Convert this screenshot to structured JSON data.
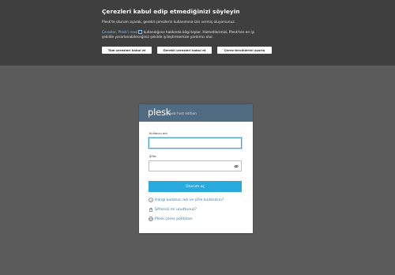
{
  "cookie_banner": {
    "title": "Çerezleri kabul edip etmediğinizi söyleyin",
    "intro": "Plesk'te oturum açarak, gerekli çerezlerin kullanımına izin vermiş oluyorsunuz.",
    "link_text": "Çerezler, Plesk'i nasıl",
    "more_text_line1": "kullandığınız hakkında bilgi toplar. Hizmetlerimizi, Plesk'ten en iyi",
    "more_text_line2": "şekilde yararlanabileceğiniz şekilde iyileştirmemize yardımcı olur.",
    "buttons": {
      "accept_all": "Tüm çerezleri kabul et",
      "accept_required": "Gerekli çerezleri kabul et",
      "configure": "Çerez tercihlerini ayarla"
    }
  },
  "login": {
    "logo": "plesk",
    "edition": "web host edition",
    "username_label": "Kullanıcı adı",
    "username_value": "",
    "password_label": "Şifre",
    "password_value": "",
    "submit_label": "Oturum aç",
    "links": {
      "which_credentials": "Hangi kullanıcı adı ve şifre kullanılsın?",
      "forgot_password": "Şifrenizi mi unuttunuz?",
      "cookie_policy": "Plesk çerez politikası"
    }
  },
  "colors": {
    "background": "#5b5b5b",
    "banner": "#3f3f3f",
    "header": "#516b82",
    "button": "#28aade",
    "link": "#2a7fb6"
  },
  "icons": {
    "external_link": "external-link-icon",
    "eye": "eye-icon",
    "question": "question-circle-icon",
    "lock": "lock-icon",
    "globe": "globe-icon"
  }
}
